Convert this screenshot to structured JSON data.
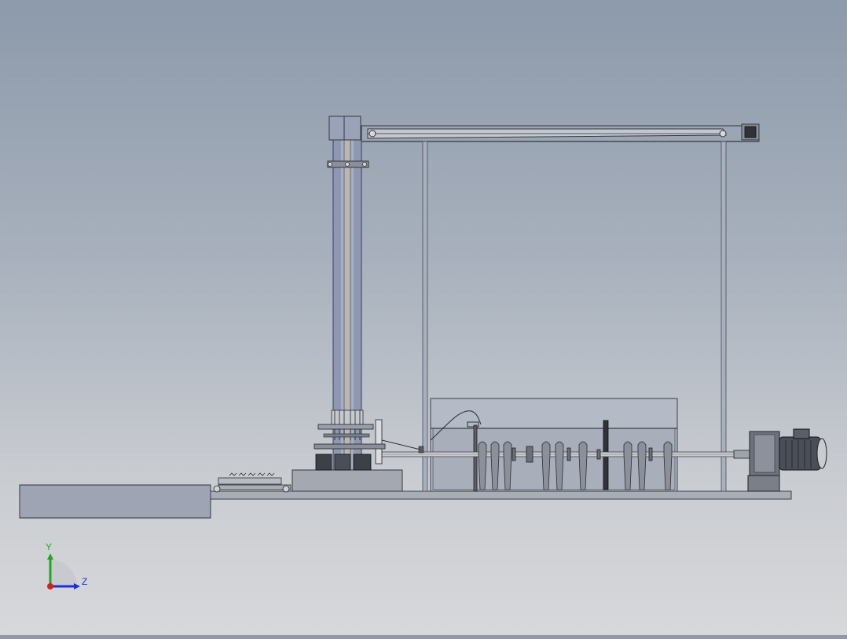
{
  "triad": {
    "y_label": "Y",
    "z_label": "Z",
    "colors": {
      "y": "#1fa81f",
      "z": "#1c2ee0",
      "x": "#d81e1e"
    }
  },
  "colors": {
    "background_top": "#8d9aab",
    "background_bottom": "#d7d8da",
    "frame": "#a8afbd",
    "tank_glass": "#b4bac6",
    "metal_dark": "#555a63",
    "motor": "#4a4e57"
  }
}
